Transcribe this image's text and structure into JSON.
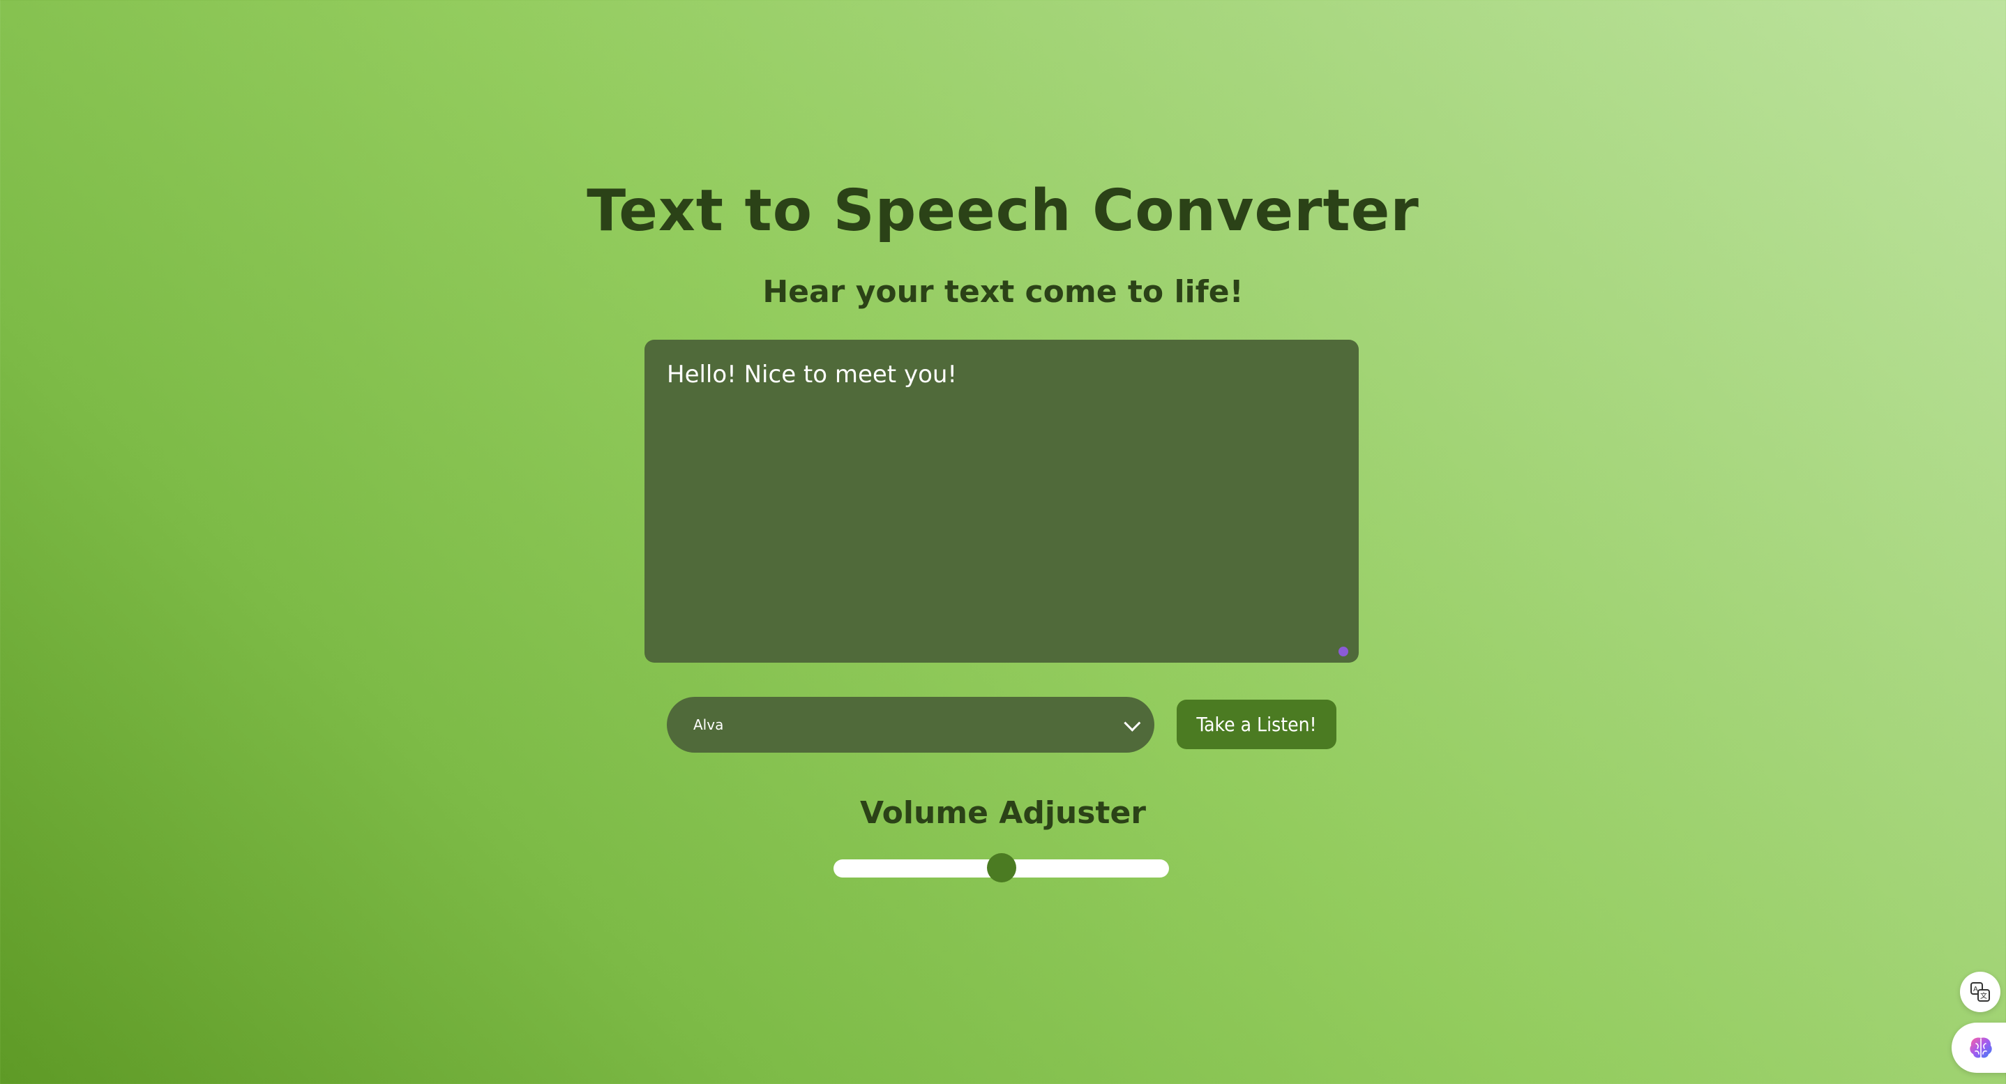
{
  "page": {
    "title": "Text to Speech Converter",
    "subtitle": "Hear your text come to life!"
  },
  "editor": {
    "text": "Hello! Nice to meet you!"
  },
  "voice_select": {
    "selected": "Alva"
  },
  "listen_button": {
    "label": "Take a Listen!"
  },
  "volume": {
    "label": "Volume Adjuster",
    "value_fraction": 0.5
  },
  "icons": {
    "translate": "translate-icon",
    "ai": "brain-icon",
    "chevron": "chevron-down-icon"
  },
  "colors": {
    "text_dark": "#2b4217",
    "panel": "#506a3a",
    "button": "#4b7b22",
    "accent_dot": "#8b5bd6"
  }
}
